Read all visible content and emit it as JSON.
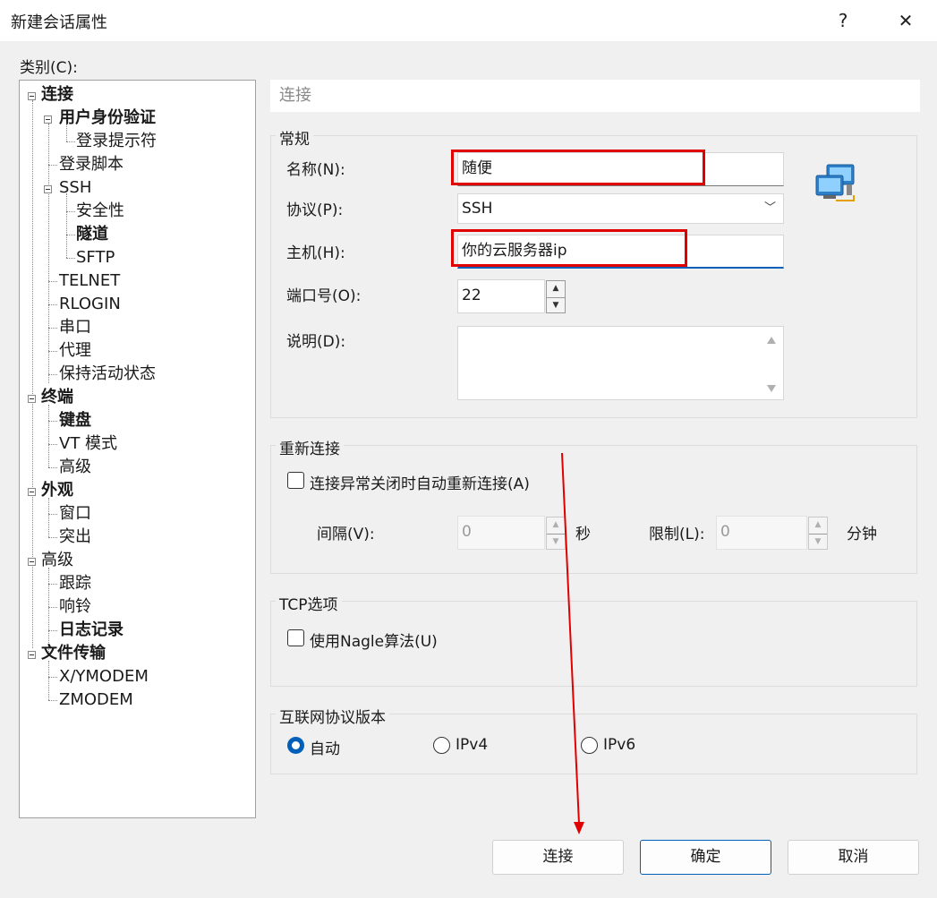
{
  "window": {
    "title": "新建会话属性",
    "help": "?",
    "close": "✕"
  },
  "category_label": "类别(C):",
  "tree": [
    {
      "label": "连接",
      "bold": true
    },
    {
      "label": "用户身份验证",
      "bold": true
    },
    {
      "label": "登录提示符",
      "bold": false
    },
    {
      "label": "登录脚本",
      "bold": false
    },
    {
      "label": "SSH",
      "bold": false
    },
    {
      "label": "安全性",
      "bold": false
    },
    {
      "label": "隧道",
      "bold": true
    },
    {
      "label": "SFTP",
      "bold": false
    },
    {
      "label": "TELNET",
      "bold": false
    },
    {
      "label": "RLOGIN",
      "bold": false
    },
    {
      "label": "串口",
      "bold": false
    },
    {
      "label": "代理",
      "bold": false
    },
    {
      "label": "保持活动状态",
      "bold": false
    },
    {
      "label": "终端",
      "bold": true
    },
    {
      "label": "键盘",
      "bold": true
    },
    {
      "label": "VT 模式",
      "bold": false
    },
    {
      "label": "高级",
      "bold": false
    },
    {
      "label": "外观",
      "bold": true
    },
    {
      "label": "窗口",
      "bold": false
    },
    {
      "label": "突出",
      "bold": false
    },
    {
      "label": "高级",
      "bold": false
    },
    {
      "label": "跟踪",
      "bold": false
    },
    {
      "label": "响铃",
      "bold": false
    },
    {
      "label": "日志记录",
      "bold": true
    },
    {
      "label": "文件传输",
      "bold": true
    },
    {
      "label": "X/YMODEM",
      "bold": false
    },
    {
      "label": "ZMODEM",
      "bold": false
    }
  ],
  "section_title": "连接",
  "general": {
    "title": "常规",
    "name_label": "名称(N):",
    "name_value": "随便",
    "protocol_label": "协议(P):",
    "protocol_value": "SSH",
    "host_label": "主机(H):",
    "host_value": "你的云服务器ip",
    "port_label": "端口号(O):",
    "port_value": "22",
    "desc_label": "说明(D):",
    "desc_value": ""
  },
  "reconnect": {
    "title": "重新连接",
    "auto_label": "连接异常关闭时自动重新连接(A)",
    "auto_checked": false,
    "interval_label": "间隔(V):",
    "interval_value": "0",
    "interval_unit": "秒",
    "limit_label": "限制(L):",
    "limit_value": "0",
    "limit_unit": "分钟"
  },
  "tcp": {
    "title": "TCP选项",
    "nagle_label": "使用Nagle算法(U)",
    "nagle_checked": false
  },
  "ip_version": {
    "title": "互联网协议版本",
    "options": [
      "自动",
      "IPv4",
      "IPv6"
    ],
    "selected": "自动"
  },
  "buttons": {
    "connect": "连接",
    "ok": "确定",
    "cancel": "取消"
  },
  "colors": {
    "accent": "#005fb8",
    "annotation_red": "#e00000"
  },
  "icons": {
    "network": "network-computers-icon"
  }
}
